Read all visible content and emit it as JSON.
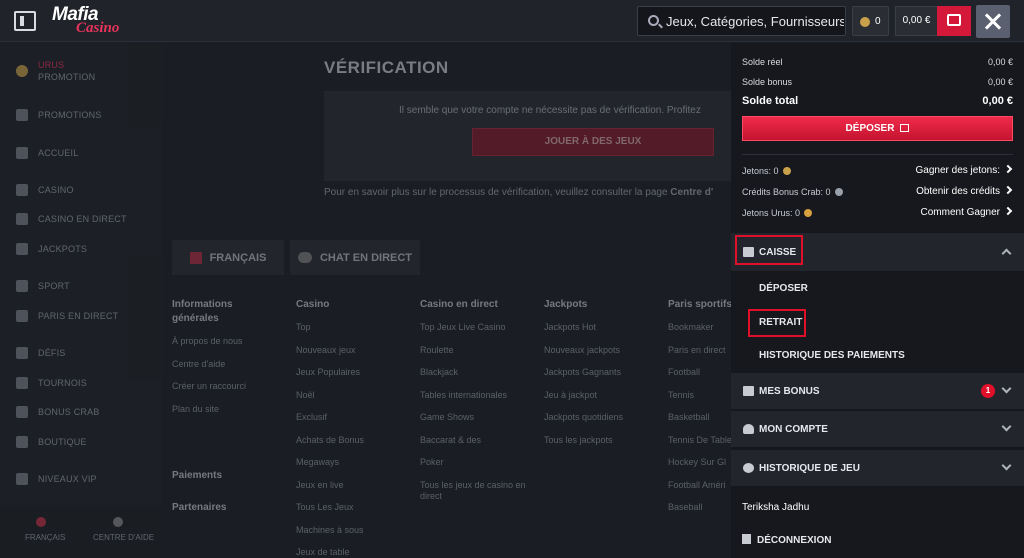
{
  "topbar": {
    "logo_top": "Mafia",
    "logo_bottom": "Casino",
    "search_placeholder": "Jeux, Catégories, Fournisseurs",
    "coins": "0",
    "balance": "0,00 €"
  },
  "sidebar": {
    "urus_line1": "URUS",
    "urus_line2": "PROMOTION",
    "items": [
      "PROMOTIONS",
      "ACCUEIL",
      "CASINO",
      "CASINO EN DIRECT",
      "JACKPOTS",
      "SPORT",
      "PARIS EN DIRECT",
      "DÉFIS",
      "TOURNOIS",
      "BONUS CRAB",
      "BOUTIQUE",
      "NIVEAUX VIP"
    ],
    "footer_language": "FRANÇAIS",
    "footer_help": "CENTRE D'AIDE"
  },
  "main": {
    "title": "VÉRIFICATION",
    "text": "Il semble que votre compte ne nécessite pas de vérification. Profitez",
    "play_button": "JOUER À DES JEUX",
    "more_info": "Pour en savoir plus sur le processus de vérification, veuillez consulter la page",
    "more_info_link": "Centre d'",
    "language_button": "FRANÇAIS",
    "chat_button": "CHAT EN DIRECT",
    "footer_columns": [
      {
        "title": "Informations générales",
        "items": [
          "À propos de nous",
          "Centre d'aide",
          "Créer un raccourci",
          "Plan du site"
        ]
      },
      {
        "title": "Casino",
        "items": [
          "Top",
          "Nouveaux jeux",
          "Jeux Populaires",
          "Noël",
          "Exclusif",
          "Achats de Bonus",
          "Megaways",
          "Jeux en live",
          "Tous Les Jeux",
          "Machines à sous",
          "Jeux de table"
        ]
      },
      {
        "title": "Casino en direct",
        "items": [
          "Top Jeux Live Casino",
          "Roulette",
          "Blackjack",
          "Tables internationales",
          "Game Shows",
          "Baccarat & des",
          "Poker",
          "Tous les jeux de casino en direct"
        ]
      },
      {
        "title": "Jackpots",
        "items": [
          "Jackpots Hot",
          "Nouveaux jackpots",
          "Jackpots Gagnants",
          "Jeu à jackpot",
          "Jackpots quotidiens",
          "Tous les jackpots"
        ]
      },
      {
        "title": "Paris sportifs",
        "items": [
          "Bookmaker",
          "Paris en direct",
          "Football",
          "Tennis",
          "Basketball",
          "Tennis De Table",
          "Hockey Sur Gl",
          "Football Améri",
          "Baseball"
        ]
      }
    ],
    "payments": "Paiements",
    "partners": "Partenaires"
  },
  "panel": {
    "real_balance_label": "Solde réel",
    "real_balance_value": "0,00 €",
    "bonus_balance_label": "Solde bonus",
    "bonus_balance_value": "0,00 €",
    "total_balance_label": "Solde total",
    "total_balance_value": "0,00 €",
    "deposit_button": "DÉPOSER",
    "tokens_label": "Jetons: 0",
    "tokens_link": "Gagner des jetons:",
    "crab_label": "Crédits Bonus Crab: 0",
    "crab_link": "Obtenir des crédits",
    "urus_label": "Jetons Urus: 0",
    "urus_link": "Comment Gagner",
    "caisse": "CAISSE",
    "caisse_items": [
      "DÉPOSER",
      "RETRAIT",
      "HISTORIQUE DES PAIEMENTS"
    ],
    "bonus": "MES BONUS",
    "bonus_count": "1",
    "account": "MON COMPTE",
    "game_history": "HISTORIQUE DE JEU",
    "username": "Teriksha Jadhu",
    "logout": "DÉCONNEXION"
  },
  "colors": {
    "accent_red": "#d3183a",
    "highlight_red": "#e0102a",
    "panel_bg": "#16181d"
  }
}
